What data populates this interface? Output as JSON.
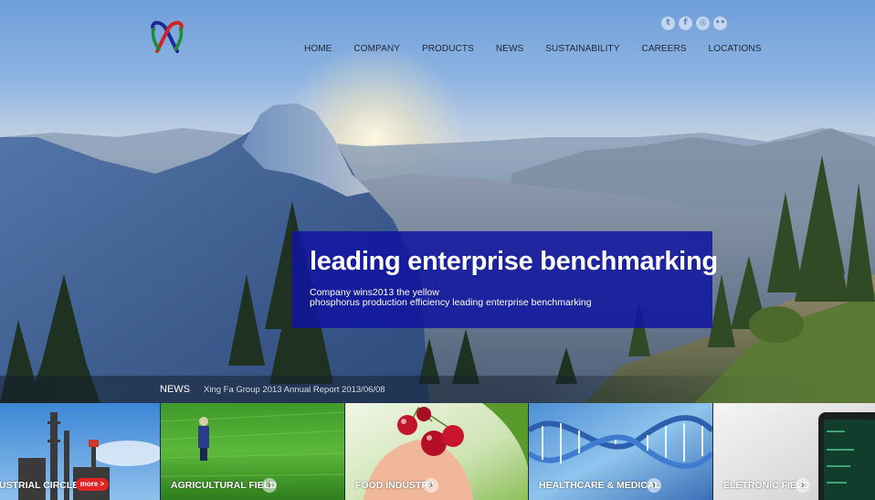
{
  "brand": {
    "colors": {
      "accent": "#1014a0",
      "more_button": "#e02323"
    }
  },
  "social": {
    "items": [
      {
        "name": "twitter-icon",
        "glyph": "t"
      },
      {
        "name": "facebook-icon",
        "glyph": "f"
      },
      {
        "name": "weibo-icon",
        "glyph": "◎"
      },
      {
        "name": "flickr-icon",
        "glyph": "••"
      }
    ]
  },
  "nav": {
    "items": [
      "HOME",
      "COMPANY",
      "PRODUCTS",
      "NEWS",
      "SUSTAINABILITY",
      "CAREERS",
      "LOCATIONS"
    ]
  },
  "banner": {
    "heading": "leading enterprise benchmarking",
    "line1": "Company wins2013 the yellow",
    "line2": "phosphorus production efficiency leading enterprise benchmarking"
  },
  "news": {
    "label": "NEWS",
    "headline": "Xing Fa Group 2013 Annual Report  2013/06/08"
  },
  "tiles": [
    {
      "label": "USTRIAL CIRCLE",
      "more": "more >"
    },
    {
      "label": "AGRICULTURAL FIELD",
      "arrow": "›"
    },
    {
      "label": "FOOD INDUSTRY",
      "arrow": "›"
    },
    {
      "label": "HEALTHCARE & MEDICAL",
      "arrow": "›"
    },
    {
      "label": "ELETRONIC FIELD",
      "arrow": "›"
    }
  ]
}
